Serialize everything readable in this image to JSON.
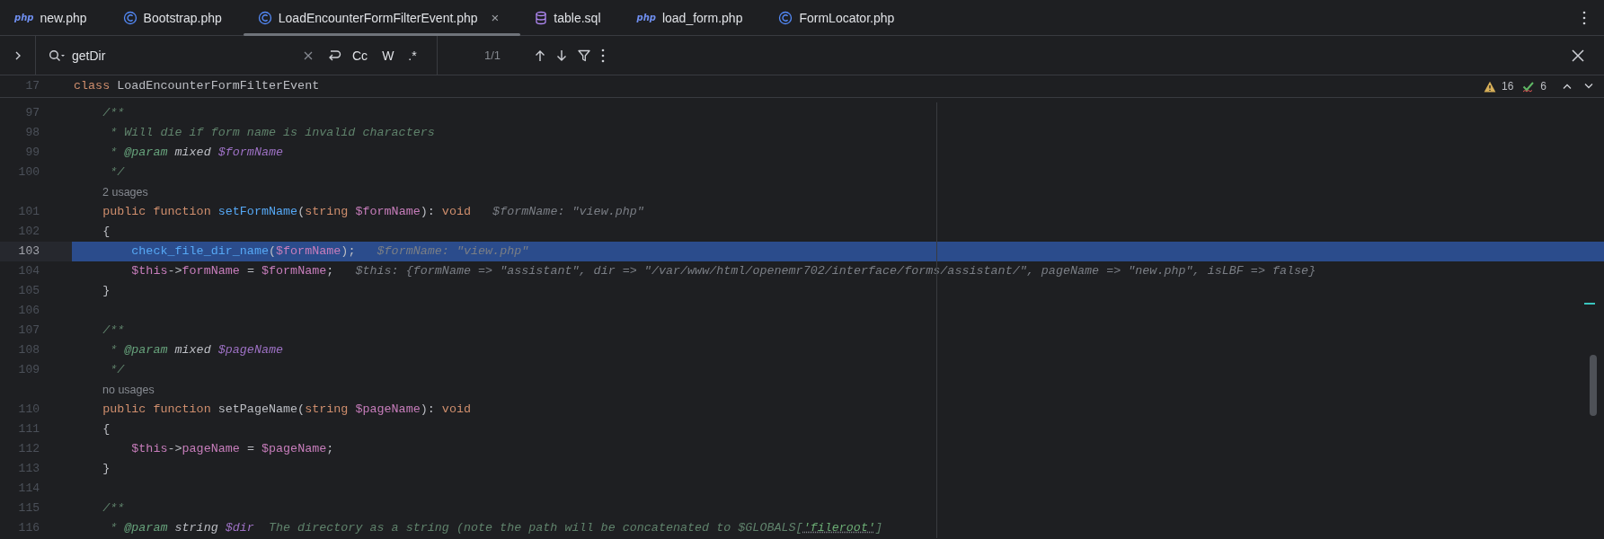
{
  "tabs": [
    {
      "label": "new.php",
      "kind": "php",
      "icon_label": "php",
      "selected": false,
      "closable": false
    },
    {
      "label": "Bootstrap.php",
      "kind": "class",
      "selected": false,
      "closable": false
    },
    {
      "label": "LoadEncounterFormFilterEvent.php",
      "kind": "class",
      "selected": true,
      "closable": true,
      "close_label": "×"
    },
    {
      "label": "table.sql",
      "kind": "database",
      "selected": false,
      "closable": false
    },
    {
      "label": "load_form.php",
      "kind": "php",
      "icon_label": "php",
      "selected": false,
      "closable": false
    },
    {
      "label": "FormLocator.php",
      "kind": "class",
      "selected": false,
      "closable": false
    }
  ],
  "find_bar": {
    "query": "getDir",
    "options": [
      {
        "label": "Cc",
        "selected": false
      },
      {
        "label": "W",
        "selected": false
      },
      {
        "label": ".*",
        "selected": false
      }
    ],
    "match_count": "1/1"
  },
  "sticky_header": {
    "number": "17",
    "tokens": [
      {
        "kind": "kw",
        "text": "class "
      },
      {
        "kind": "plain",
        "text": "LoadEncounterFormFilterEvent"
      }
    ]
  },
  "inspections": {
    "warnings": "16",
    "checks": "6"
  },
  "lines": [
    {
      "kind": "code",
      "number": "97",
      "selected": false,
      "tokens": [
        {
          "kind": "comment",
          "text": "    /**"
        }
      ]
    },
    {
      "kind": "code",
      "number": "98",
      "selected": false,
      "tokens": [
        {
          "kind": "comment",
          "text": "     * Will die if form name is invalid characters"
        }
      ]
    },
    {
      "kind": "code",
      "number": "99",
      "selected": false,
      "tokens": [
        {
          "kind": "comment",
          "text": "     * "
        },
        {
          "kind": "doctag",
          "text": "@param"
        },
        {
          "kind": "doctype",
          "text": " mixed"
        },
        {
          "kind": "docvar",
          "text": " $formName"
        }
      ]
    },
    {
      "kind": "code",
      "number": "100",
      "selected": false,
      "tokens": [
        {
          "kind": "comment",
          "text": "     */"
        }
      ]
    },
    {
      "kind": "usages",
      "text": "2 usages"
    },
    {
      "kind": "code",
      "number": "101",
      "selected": false,
      "tokens": [
        {
          "kind": "kw",
          "text": "    public function "
        },
        {
          "kind": "fn",
          "text": "setFormName"
        },
        {
          "kind": "plain",
          "text": "("
        },
        {
          "kind": "kw",
          "text": "string "
        },
        {
          "kind": "var",
          "text": "$formName"
        },
        {
          "kind": "plain",
          "text": "): "
        },
        {
          "kind": "kw",
          "text": "void"
        },
        {
          "kind": "hint",
          "text": "   $formName: \"view.php\""
        }
      ]
    },
    {
      "kind": "code",
      "number": "102",
      "selected": false,
      "tokens": [
        {
          "kind": "plain",
          "text": "    {"
        }
      ]
    },
    {
      "kind": "code",
      "number": "103",
      "selected": true,
      "tokens": [
        {
          "kind": "fn",
          "text": "        check_file_dir_name"
        },
        {
          "kind": "plain",
          "text": "("
        },
        {
          "kind": "var",
          "text": "$formName"
        },
        {
          "kind": "plain",
          "text": ");"
        },
        {
          "kind": "hint",
          "text": "   $formName: \"view.php\""
        }
      ]
    },
    {
      "kind": "code",
      "number": "104",
      "selected": false,
      "tokens": [
        {
          "kind": "var",
          "text": "        $this"
        },
        {
          "kind": "plain",
          "text": "->"
        },
        {
          "kind": "field",
          "text": "formName"
        },
        {
          "kind": "plain",
          "text": " = "
        },
        {
          "kind": "var",
          "text": "$formName"
        },
        {
          "kind": "plain",
          "text": ";"
        },
        {
          "kind": "hint",
          "text": "   $this: {formName => \"assistant\", dir => \"/var/www/html/openemr702/interface/forms/assistant/\", pageName => \"new.php\", isLBF => false}"
        }
      ]
    },
    {
      "kind": "code",
      "number": "105",
      "selected": false,
      "tokens": [
        {
          "kind": "plain",
          "text": "    }"
        }
      ]
    },
    {
      "kind": "code",
      "number": "106",
      "selected": false
    },
    {
      "kind": "code",
      "number": "107",
      "selected": false,
      "tokens": [
        {
          "kind": "comment",
          "text": "    /**"
        }
      ]
    },
    {
      "kind": "code",
      "number": "108",
      "selected": false,
      "tokens": [
        {
          "kind": "comment",
          "text": "     * "
        },
        {
          "kind": "doctag",
          "text": "@param"
        },
        {
          "kind": "doctype",
          "text": " mixed"
        },
        {
          "kind": "docvar",
          "text": " $pageName"
        }
      ]
    },
    {
      "kind": "code",
      "number": "109",
      "selected": false,
      "tokens": [
        {
          "kind": "comment",
          "text": "     */"
        }
      ]
    },
    {
      "kind": "usages",
      "text": "no usages"
    },
    {
      "kind": "code",
      "number": "110",
      "selected": false,
      "tokens": [
        {
          "kind": "kw",
          "text": "    public function "
        },
        {
          "kind": "plain",
          "text": "setPageName("
        },
        {
          "kind": "kw",
          "text": "string "
        },
        {
          "kind": "var",
          "text": "$pageName"
        },
        {
          "kind": "plain",
          "text": "): "
        },
        {
          "kind": "kw",
          "text": "void"
        }
      ]
    },
    {
      "kind": "code",
      "number": "111",
      "selected": false,
      "tokens": [
        {
          "kind": "plain",
          "text": "    {"
        }
      ]
    },
    {
      "kind": "code",
      "number": "112",
      "selected": false,
      "tokens": [
        {
          "kind": "var",
          "text": "        $this"
        },
        {
          "kind": "plain",
          "text": "->"
        },
        {
          "kind": "field",
          "text": "pageName"
        },
        {
          "kind": "plain",
          "text": " = "
        },
        {
          "kind": "var",
          "text": "$pageName"
        },
        {
          "kind": "plain",
          "text": ";"
        }
      ]
    },
    {
      "kind": "code",
      "number": "113",
      "selected": false,
      "tokens": [
        {
          "kind": "plain",
          "text": "    }"
        }
      ]
    },
    {
      "kind": "code",
      "number": "114",
      "selected": false
    },
    {
      "kind": "code",
      "number": "115",
      "selected": false,
      "tokens": [
        {
          "kind": "comment",
          "text": "    /**"
        }
      ]
    },
    {
      "kind": "code",
      "number": "116",
      "selected": false,
      "tokens": [
        {
          "kind": "comment",
          "text": "     * "
        },
        {
          "kind": "doctag",
          "text": "@param"
        },
        {
          "kind": "doctype",
          "text": " string"
        },
        {
          "kind": "docvar",
          "text": " $dir"
        },
        {
          "kind": "comment",
          "text": "  The directory as a string (note the path will be concatenated to $GLOBALS["
        },
        {
          "kind": "docstr",
          "text": "'fileroot'"
        },
        {
          "kind": "comment",
          "text": "]"
        }
      ]
    }
  ]
}
